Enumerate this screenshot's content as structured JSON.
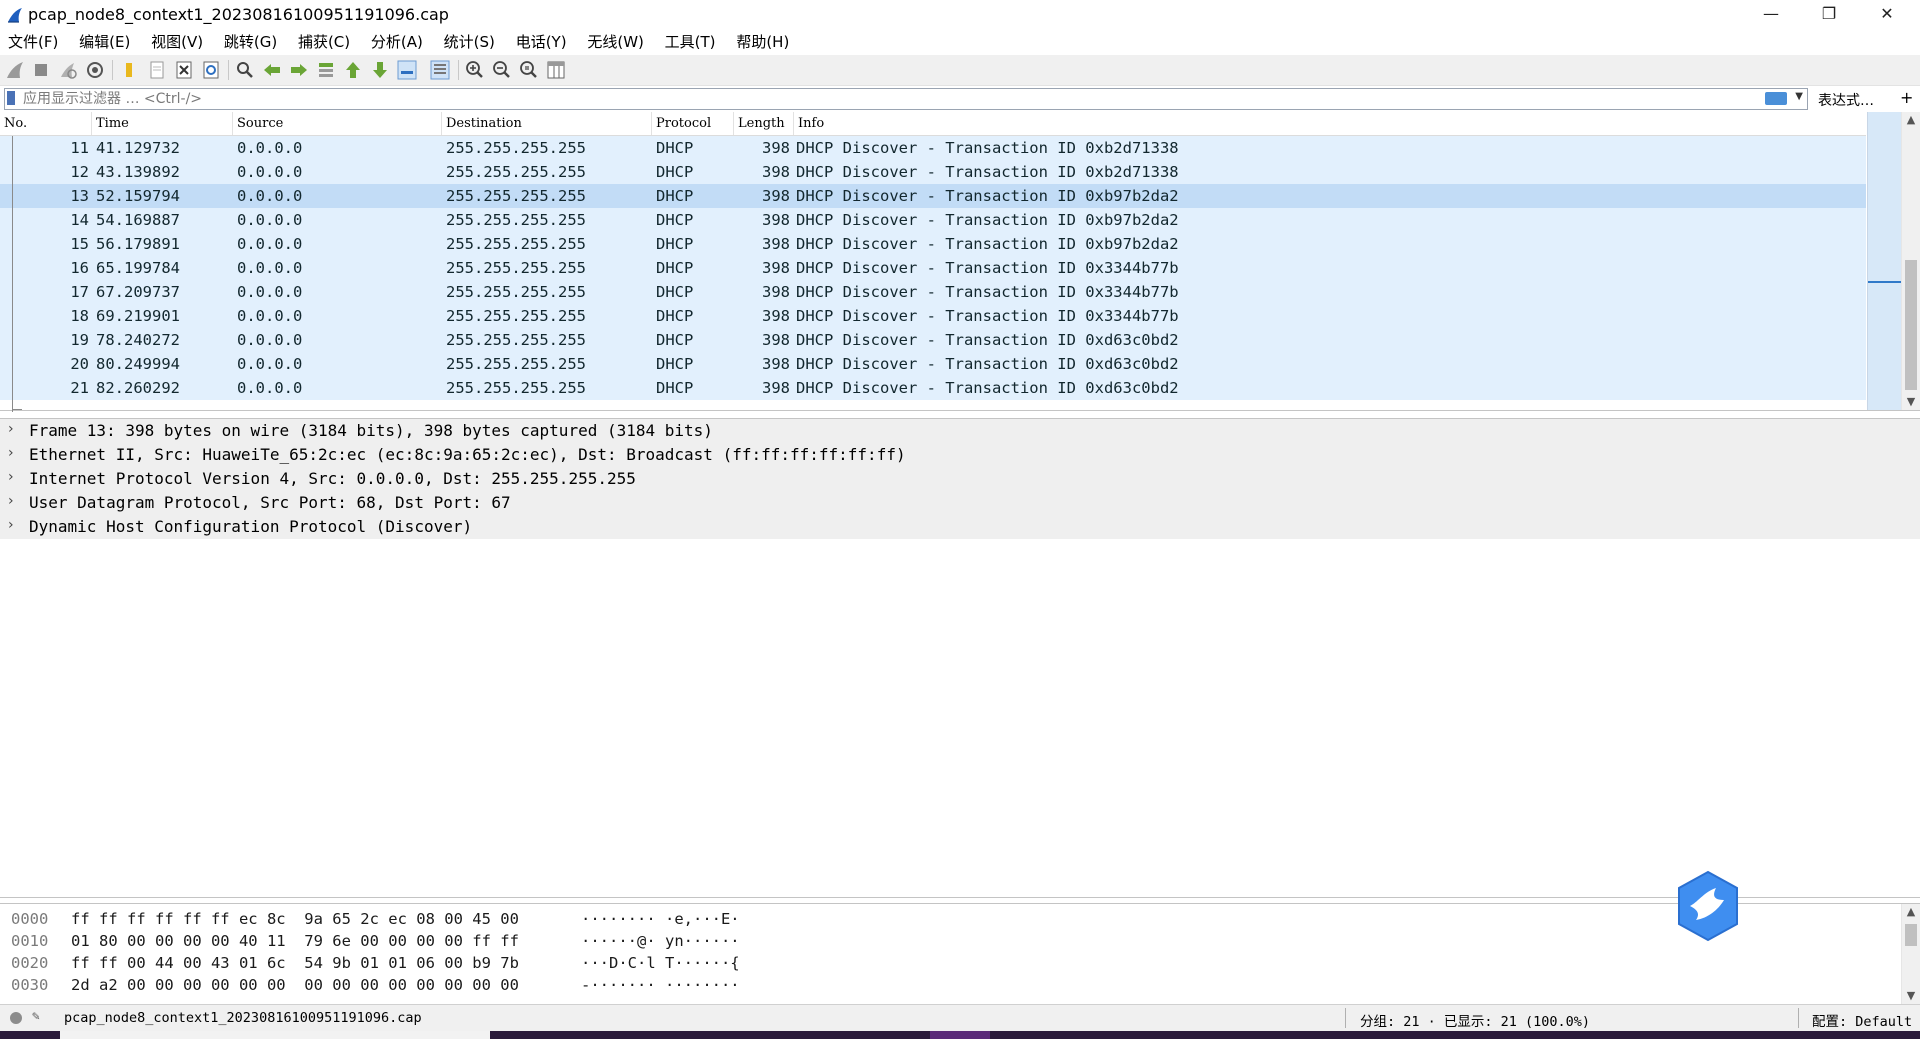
{
  "window": {
    "title": "pcap_node8_context1_20230816100951191096.cap",
    "minimize_glyph": "—",
    "restore_glyph": "❐",
    "close_glyph": "✕"
  },
  "menu": [
    "文件(F)",
    "编辑(E)",
    "视图(V)",
    "跳转(G)",
    "捕获(C)",
    "分析(A)",
    "统计(S)",
    "电话(Y)",
    "无线(W)",
    "工具(T)",
    "帮助(H)"
  ],
  "filter": {
    "placeholder": "应用显示过滤器 … <Ctrl-/>",
    "expression_label": "表达式…",
    "plus_label": "+"
  },
  "columns": {
    "no": "No.",
    "time": "Time",
    "source": "Source",
    "destination": "Destination",
    "protocol": "Protocol",
    "length": "Length",
    "info": "Info"
  },
  "packets": [
    {
      "no": "11",
      "time": "41.129732",
      "source": "0.0.0.0",
      "destination": "255.255.255.255",
      "protocol": "DHCP",
      "length": "398",
      "info": "DHCP Discover - Transaction ID 0xb2d71338"
    },
    {
      "no": "12",
      "time": "43.139892",
      "source": "0.0.0.0",
      "destination": "255.255.255.255",
      "protocol": "DHCP",
      "length": "398",
      "info": "DHCP Discover - Transaction ID 0xb2d71338"
    },
    {
      "no": "13",
      "time": "52.159794",
      "source": "0.0.0.0",
      "destination": "255.255.255.255",
      "protocol": "DHCP",
      "length": "398",
      "info": "DHCP Discover - Transaction ID 0xb97b2da2",
      "selected": true
    },
    {
      "no": "14",
      "time": "54.169887",
      "source": "0.0.0.0",
      "destination": "255.255.255.255",
      "protocol": "DHCP",
      "length": "398",
      "info": "DHCP Discover - Transaction ID 0xb97b2da2"
    },
    {
      "no": "15",
      "time": "56.179891",
      "source": "0.0.0.0",
      "destination": "255.255.255.255",
      "protocol": "DHCP",
      "length": "398",
      "info": "DHCP Discover - Transaction ID 0xb97b2da2"
    },
    {
      "no": "16",
      "time": "65.199784",
      "source": "0.0.0.0",
      "destination": "255.255.255.255",
      "protocol": "DHCP",
      "length": "398",
      "info": "DHCP Discover - Transaction ID 0x3344b77b"
    },
    {
      "no": "17",
      "time": "67.209737",
      "source": "0.0.0.0",
      "destination": "255.255.255.255",
      "protocol": "DHCP",
      "length": "398",
      "info": "DHCP Discover - Transaction ID 0x3344b77b"
    },
    {
      "no": "18",
      "time": "69.219901",
      "source": "0.0.0.0",
      "destination": "255.255.255.255",
      "protocol": "DHCP",
      "length": "398",
      "info": "DHCP Discover - Transaction ID 0x3344b77b"
    },
    {
      "no": "19",
      "time": "78.240272",
      "source": "0.0.0.0",
      "destination": "255.255.255.255",
      "protocol": "DHCP",
      "length": "398",
      "info": "DHCP Discover - Transaction ID 0xd63c0bd2"
    },
    {
      "no": "20",
      "time": "80.249994",
      "source": "0.0.0.0",
      "destination": "255.255.255.255",
      "protocol": "DHCP",
      "length": "398",
      "info": "DHCP Discover - Transaction ID 0xd63c0bd2"
    },
    {
      "no": "21",
      "time": "82.260292",
      "source": "0.0.0.0",
      "destination": "255.255.255.255",
      "protocol": "DHCP",
      "length": "398",
      "info": "DHCP Discover - Transaction ID 0xd63c0bd2"
    }
  ],
  "details": [
    "Frame 13: 398 bytes on wire (3184 bits), 398 bytes captured (3184 bits)",
    "Ethernet II, Src: HuaweiTe_65:2c:ec (ec:8c:9a:65:2c:ec), Dst: Broadcast (ff:ff:ff:ff:ff:ff)",
    "Internet Protocol Version 4, Src: 0.0.0.0, Dst: 255.255.255.255",
    "User Datagram Protocol, Src Port: 68, Dst Port: 67",
    "Dynamic Host Configuration Protocol (Discover)"
  ],
  "bytes": [
    {
      "offset": "0000",
      "hex": "ff ff ff ff ff ff ec 8c  9a 65 2c ec 08 00 45 00",
      "ascii": "········ ·e,···E·"
    },
    {
      "offset": "0010",
      "hex": "01 80 00 00 00 00 40 11  79 6e 00 00 00 00 ff ff",
      "ascii": "······@· yn······"
    },
    {
      "offset": "0020",
      "hex": "ff ff 00 44 00 43 01 6c  54 9b 01 01 06 00 b9 7b",
      "ascii": "···D·C·l T······{"
    },
    {
      "offset": "0030",
      "hex": "2d a2 00 00 00 00 00 00  00 00 00 00 00 00 00 00",
      "ascii": "-······· ········"
    }
  ],
  "status": {
    "file": "pcap_node8_context1_20230816100951191096.cap",
    "stats": "分组: 21 · 已显示: 21 (100.0%)",
    "profile": "配置: Default"
  },
  "colors": {
    "row_bg": "#e2f0fd",
    "row_selected": "#c2dcf6",
    "detail_bg": "#efefef",
    "accent": "#2f79c9"
  }
}
